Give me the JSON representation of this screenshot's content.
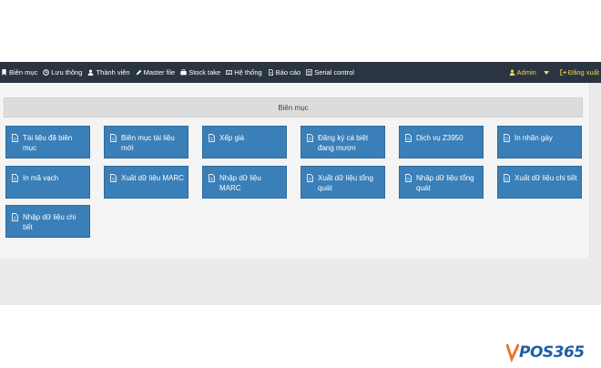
{
  "nav": {
    "items": [
      {
        "label": "Biên mục",
        "icon": "bookmark-icon"
      },
      {
        "label": "Lưu thông",
        "icon": "clock-icon"
      },
      {
        "label": "Thành viên",
        "icon": "user-icon"
      },
      {
        "label": "Master file",
        "icon": "pencil-icon"
      },
      {
        "label": "Stock take",
        "icon": "briefcase-icon"
      },
      {
        "label": "Hệ thống",
        "icon": "keyboard-icon"
      },
      {
        "label": "Báo cáo",
        "icon": "document-icon"
      },
      {
        "label": "Serial control",
        "icon": "list-icon"
      }
    ],
    "admin_label": "Admin",
    "logout_label": "Đăng xuất"
  },
  "panel": {
    "title": "Biên mục",
    "tiles": [
      "Tài liệu đã biên mục",
      "Biên mục tài liệu mới",
      "Xếp giá",
      "Đăng ký cá biệt đang mượn",
      "Dịch vụ Z3950",
      "In nhãn gáy",
      "In mã vạch",
      "Xuất dữ liệu MARC",
      "Nhập dữ liệu MARC",
      "Xuất dữ liệu tổng quát",
      "Nhập dữ liệu tổng quát",
      "Xuất dữ liệu chi tiết",
      "Nhập dữ liệu chi tiết"
    ]
  },
  "logo": {
    "text": "POS365"
  },
  "colors": {
    "navbar": "#2b3542",
    "tile": "#3a7fb8",
    "accent": "#f3d24a",
    "logo": "#1f5fa8"
  }
}
